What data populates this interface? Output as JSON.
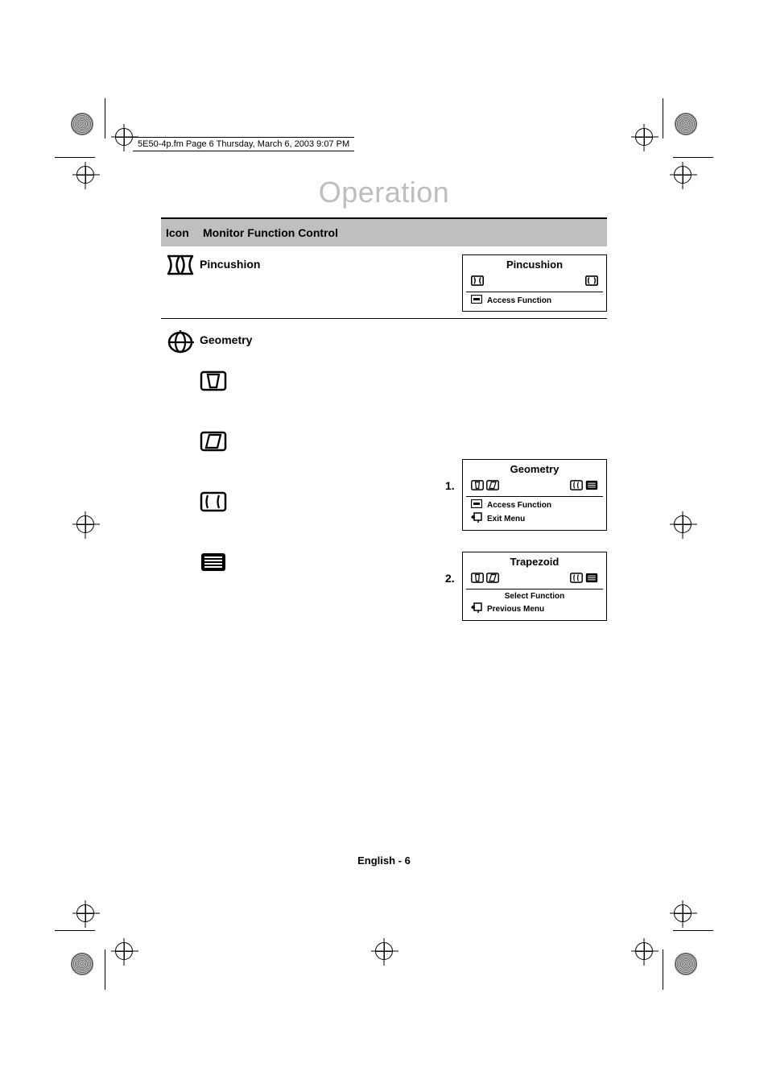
{
  "header_line": "5E50-4p.fm  Page 6  Thursday, March 6, 2003  9:07 PM",
  "page_title": "Operation",
  "table": {
    "col_icon": "Icon",
    "col_func": "Monitor Function Control"
  },
  "rows": {
    "pincushion": {
      "label": "Pincushion"
    },
    "geometry": {
      "label": "Geometry"
    }
  },
  "osd": {
    "pincushion": {
      "title": "Pincushion",
      "line1": "Access Function"
    },
    "geometry": {
      "step1_num": "1.",
      "title": "Geometry",
      "line1": "Access Function",
      "line2": "Exit Menu"
    },
    "trapezoid": {
      "step2_num": "2.",
      "title": "Trapezoid",
      "line1": "Select Function",
      "line2": "Previous Menu"
    }
  },
  "footer": "English - 6"
}
